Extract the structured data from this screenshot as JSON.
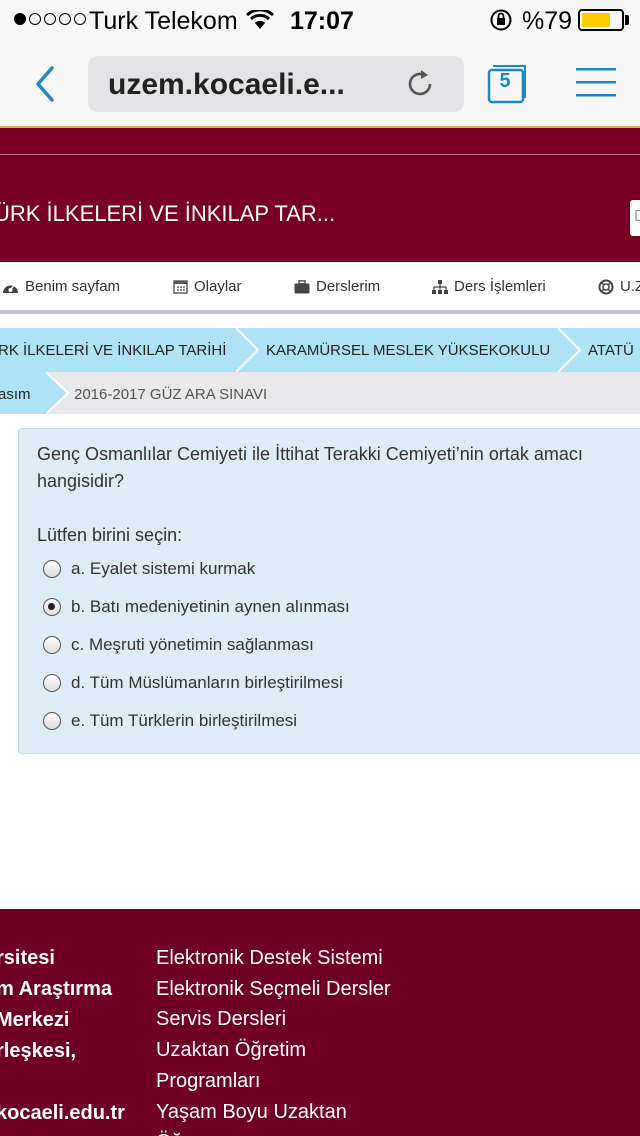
{
  "status_bar": {
    "carrier": "Turk Telekom",
    "time": "17:07",
    "battery": "%79",
    "signal_dots_filled": 1,
    "signal_dots_total": 5,
    "battery_level": 0.79
  },
  "browser": {
    "url": "uzem.kocaeli.e...",
    "tab_count": "5"
  },
  "header": {
    "course_title": "ÜRK İLKELERİ VE İNKILAP TAR...",
    "search_placeholder": "D"
  },
  "nav": {
    "items": [
      {
        "label": "Benim sayfam",
        "icon": "dashboard-icon"
      },
      {
        "label": "Olaylar",
        "icon": "calendar-icon"
      },
      {
        "label": "Derslerim",
        "icon": "briefcase-icon"
      },
      {
        "label": "Ders İşlemleri",
        "icon": "sitemap-icon"
      },
      {
        "label": "U.Z",
        "icon": "lifebuoy-icon"
      }
    ]
  },
  "breadcrumb": {
    "row1": [
      "RK İLKELERİ VE İNKILAP TARİHİ",
      "KARAMÜRSEL MESLEK YÜKSEKOKULU",
      "ATATÜ"
    ],
    "row2": [
      "asım",
      "2016-2017 GÜZ ARA SINAVI"
    ]
  },
  "question": {
    "text": "Genç Osmanlılar Cemiyeti ile İttihat Terakki Cemiyeti’nin ortak amacı hangisidir?",
    "prompt": "Lütfen birini seçin:",
    "options": [
      {
        "label": "a. Eyalet sistemi kurmak",
        "selected": false
      },
      {
        "label": "b. Batı medeniyetinin aynen alınması",
        "selected": true
      },
      {
        "label": "c. Meşruti yönetimin sağlanması",
        "selected": false
      },
      {
        "label": "d. Tüm Müslümanların birleştirilmesi",
        "selected": false
      },
      {
        "label": "e. Tüm Türklerin birleştirilmesi",
        "selected": false
      }
    ]
  },
  "footer": {
    "left_lines": [
      "rsitesi",
      "m Araştırma",
      " Merkezi",
      "rleşkesi,",
      "",
      "kocaeli.edu.tr"
    ],
    "right_lines": [
      "Elektronik Destek Sistemi",
      "Elektronik Seçmeli Dersler",
      "Servis Dersleri",
      "Uzaktan Öğretim",
      "Programları",
      "Yaşam Boyu Uzaktan",
      "Öğ"
    ]
  },
  "colors": {
    "maroon": "#790025",
    "breadcrumb_blue": "#aee3f7",
    "panel_blue": "#dcedf7",
    "battery_yellow": "#ffcc00",
    "ios_blue": "#1e88c7"
  }
}
